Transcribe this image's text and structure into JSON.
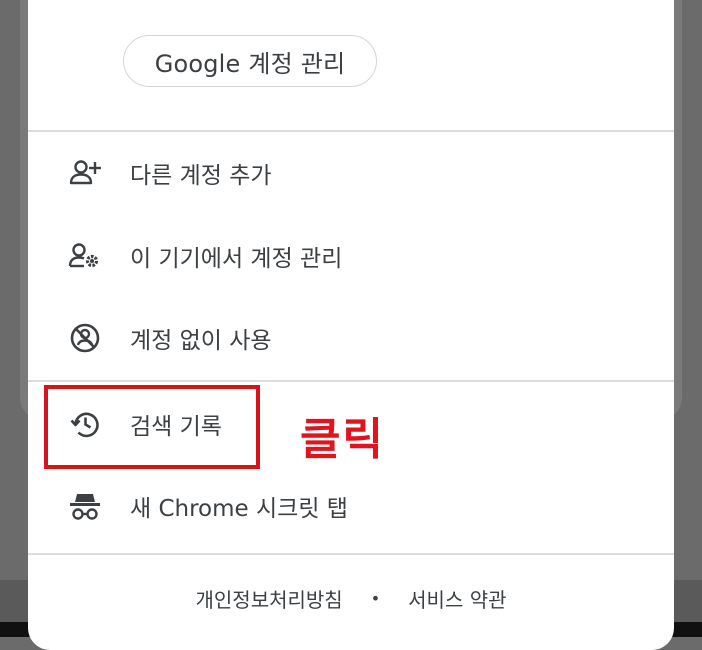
{
  "account": {
    "manage_label": "Google 계정 관리"
  },
  "menu": {
    "items": [
      {
        "label": "다른 계정 추가",
        "icon": "add-person-icon"
      },
      {
        "label": "이 기기에서 계정 관리",
        "icon": "manage-accounts-icon"
      },
      {
        "label": "계정 없이 사용",
        "icon": "no-account-icon"
      },
      {
        "label": "검색 기록",
        "icon": "history-icon"
      },
      {
        "label": "새 Chrome 시크릿 탭",
        "icon": "incognito-icon"
      }
    ]
  },
  "annotation": {
    "click_label": "클릭",
    "color": "#e2131c"
  },
  "footer": {
    "privacy_label": "개인정보처리방침",
    "separator": "•",
    "terms_label": "서비스 약관"
  }
}
